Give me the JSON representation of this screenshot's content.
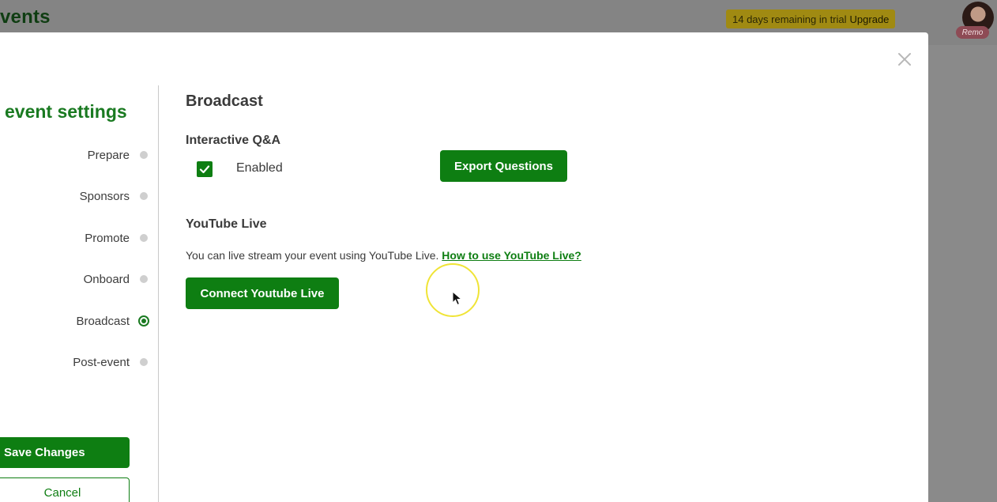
{
  "app": {
    "title_fragment": "vents",
    "trial_text": "14 days remaining in trial",
    "upgrade_label": "Upgrade",
    "avatar_badge": "Remo"
  },
  "modal": {
    "sidebar_title": "event settings",
    "nav": [
      {
        "label": "Prepare",
        "active": false
      },
      {
        "label": "Sponsors",
        "active": false
      },
      {
        "label": "Promote",
        "active": false
      },
      {
        "label": "Onboard",
        "active": false
      },
      {
        "label": "Broadcast",
        "active": true
      },
      {
        "label": "Post-event",
        "active": false
      }
    ],
    "save_label": "Save Changes",
    "cancel_label": "Cancel",
    "close_icon": "close-icon"
  },
  "broadcast": {
    "heading": "Broadcast",
    "qa_heading": "Interactive Q&A",
    "qa_enabled": true,
    "enabled_label": "Enabled",
    "export_label": "Export Questions",
    "youtube_heading": "YouTube Live",
    "youtube_desc": "You can live stream your event using YouTube Live.",
    "youtube_link": "How to use YouTube Live?",
    "connect_label": "Connect Youtube Live"
  },
  "colors": {
    "accent": "#0e7e12",
    "title_green": "#1a7a21",
    "cursor_highlight": "#f0e436"
  }
}
